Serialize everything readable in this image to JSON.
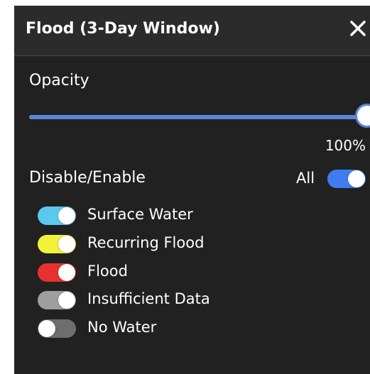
{
  "panel": {
    "title": "Flood (3-Day Window)",
    "close_icon": "close-icon"
  },
  "opacity": {
    "label": "Opacity",
    "value_text": "100%",
    "value_fraction": 1.0,
    "accent_color": "#5b84d6"
  },
  "layers_control": {
    "label": "Disable/Enable",
    "all_label": "All",
    "all_enabled": true,
    "all_toggle_color": "#3d7df0"
  },
  "layers": [
    {
      "label": "Surface Water",
      "enabled": true,
      "color": "#5cc8f0"
    },
    {
      "label": "Recurring Flood",
      "enabled": true,
      "color": "#f2f23a"
    },
    {
      "label": "Flood",
      "enabled": true,
      "color": "#e8312f"
    },
    {
      "label": "Insufficient Data",
      "enabled": true,
      "color": "#9e9e9e"
    },
    {
      "label": "No Water",
      "enabled": false,
      "color": "#6e6e6e"
    }
  ]
}
